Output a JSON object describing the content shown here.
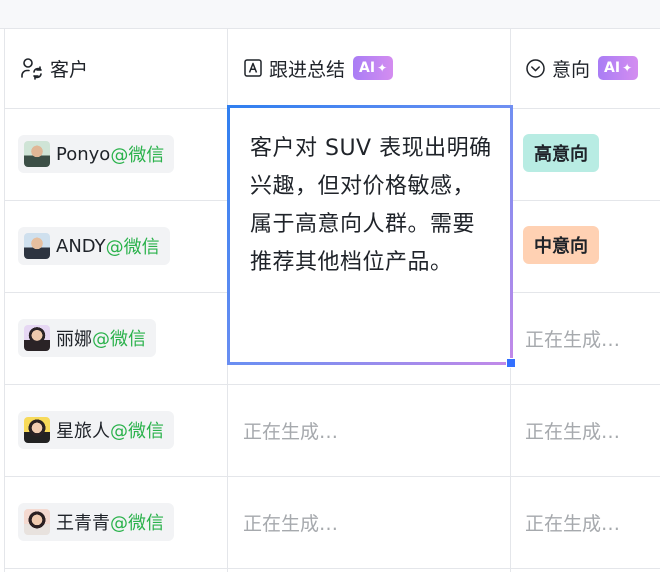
{
  "columns": {
    "customer": {
      "label": "客户",
      "icon": "customer-contact-icon"
    },
    "followup": {
      "label": "跟进总结",
      "icon": "text-field-icon",
      "ai_badge": "AI"
    },
    "intent": {
      "label": "意向",
      "icon": "select-circle-icon",
      "ai_badge": "AI"
    }
  },
  "rows": [
    {
      "name": "Ponyo",
      "suffix": "@微信",
      "followup": "",
      "intent": "高意向"
    },
    {
      "name": "ANDY",
      "suffix": "@微信",
      "followup": "",
      "intent": "中意向"
    },
    {
      "name": "丽娜",
      "suffix": "@微信",
      "followup": "",
      "intent": "正在生成…"
    },
    {
      "name": "星旅人",
      "suffix": "@微信",
      "followup": "正在生成…",
      "intent": "正在生成…"
    },
    {
      "name": "王青青",
      "suffix": "@微信",
      "followup": "正在生成…",
      "intent": "正在生成…"
    }
  ],
  "editor": {
    "text": "客户对 SUV 表现出明确兴趣，但对价格敏感，属于高意向人群。需要推荐其他档位产品。"
  },
  "colors": {
    "high_intent_bg": "#b8ece3",
    "mid_intent_bg": "#ffd1b3",
    "wechat_green": "#2bb24c",
    "generating_gray": "#a6a9ad",
    "ai_badge_gradient": [
      "#a97df5",
      "#d48df0"
    ],
    "selection_blue": "#3370ff"
  }
}
